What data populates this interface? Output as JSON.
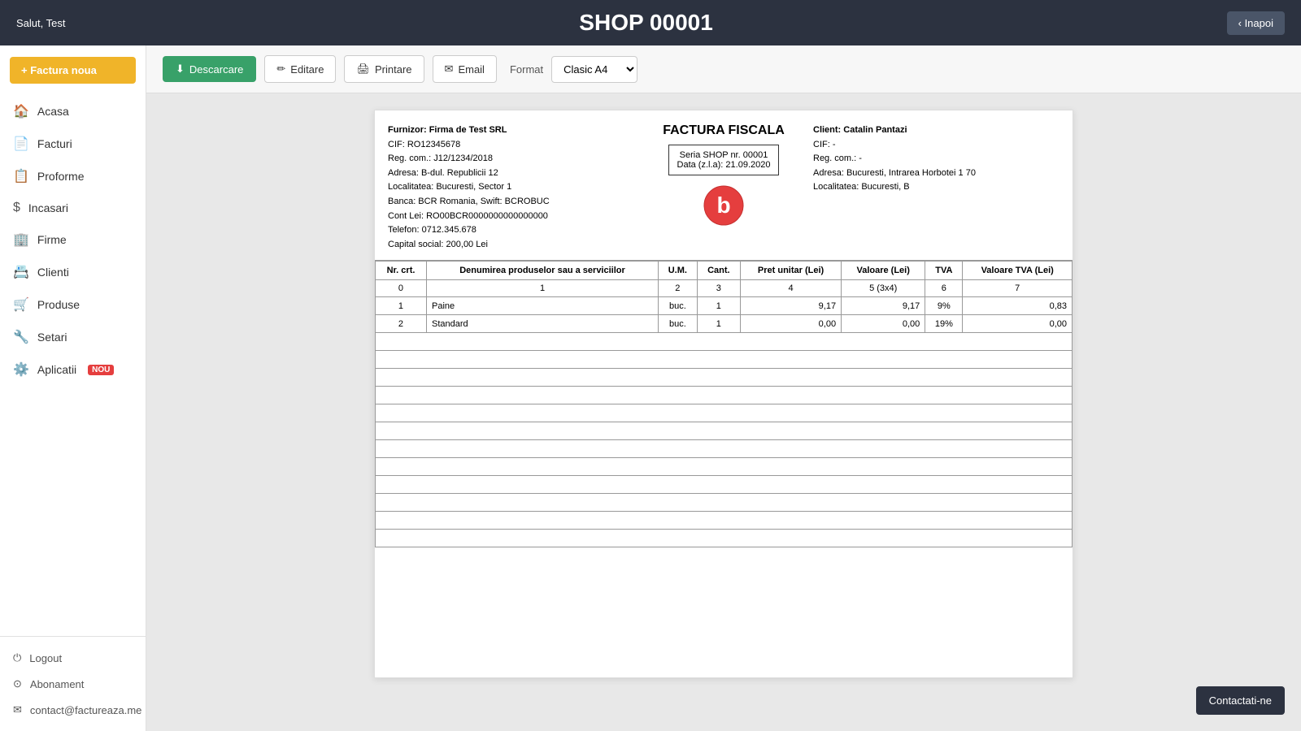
{
  "header": {
    "greeting": "Salut, Test",
    "shop_title": "SHOP 00001",
    "back_label": "‹ Inapoi"
  },
  "sidebar": {
    "new_invoice_label": "+ Factura noua",
    "nav_items": [
      {
        "label": "Acasa",
        "icon": "🏠"
      },
      {
        "label": "Facturi",
        "icon": "📄"
      },
      {
        "label": "Proforme",
        "icon": "📋"
      },
      {
        "label": "Incasari",
        "icon": "$"
      },
      {
        "label": "Firme",
        "icon": "🏢"
      },
      {
        "label": "Clienti",
        "icon": "📇"
      },
      {
        "label": "Produse",
        "icon": "🛒"
      },
      {
        "label": "Setari",
        "icon": "🔧"
      },
      {
        "label": "Aplicatii",
        "icon": "⚙️",
        "badge": "NOU"
      }
    ],
    "bottom_items": [
      {
        "label": "Logout",
        "icon": "⏻"
      },
      {
        "label": "Abonament",
        "icon": "⊙"
      },
      {
        "label": "contact@factureaza.me",
        "icon": "✉"
      }
    ]
  },
  "toolbar": {
    "download_label": "Descarcare",
    "edit_label": "Editare",
    "print_label": "Printare",
    "email_label": "Email",
    "format_label": "Format",
    "format_value": "Clasic A4"
  },
  "invoice": {
    "supplier": {
      "name": "Furnizor: Firma de Test SRL",
      "cif": "CIF: RO12345678",
      "reg": "Reg. com.: J12/1234/2018",
      "address": "Adresa: B-dul. Republicii 12",
      "locality": "Localitatea: Bucuresti, Sector 1",
      "bank": "Banca: BCR Romania, Swift: BCROBUC",
      "cont": "Cont Lei: RO00BCR0000000000000000",
      "phone": "Telefon: 0712.345.678",
      "capital": "Capital social: 200,00 Lei"
    },
    "title": "FACTURA FISCALA",
    "seria": "Seria SHOP nr. 00001",
    "data": "Data (z.l.a): 21.09.2020",
    "client": {
      "name": "Client: Catalin Pantazi",
      "cif": "CIF: -",
      "reg": "Reg. com.: -",
      "address": "Adresa: Bucuresti, Intrarea Horbotei 1 70",
      "locality": "Localitatea: Bucuresti, B"
    },
    "table": {
      "headers": [
        "Nr. crt.",
        "Denumirea produselor sau a serviciilor",
        "U.M.",
        "Cant.",
        "Pret unitar (Lei)",
        "Valoare (Lei)",
        "TVA",
        "Valoare TVA (Lei)"
      ],
      "header_row0": [
        "0",
        "1",
        "2",
        "3",
        "4",
        "5 (3x4)",
        "6",
        "7"
      ],
      "rows": [
        {
          "nr": "1",
          "denumire": "Paine",
          "um": "buc.",
          "cant": "1",
          "pret": "9,17",
          "valoare": "9,17",
          "tva": "9%",
          "val_tva": "0,83"
        },
        {
          "nr": "2",
          "denumire": "Standard",
          "um": "buc.",
          "cant": "1",
          "pret": "0,00",
          "valoare": "0,00",
          "tva": "19%",
          "val_tva": "0,00"
        }
      ]
    }
  },
  "contact": {
    "label": "Contactati-ne"
  }
}
